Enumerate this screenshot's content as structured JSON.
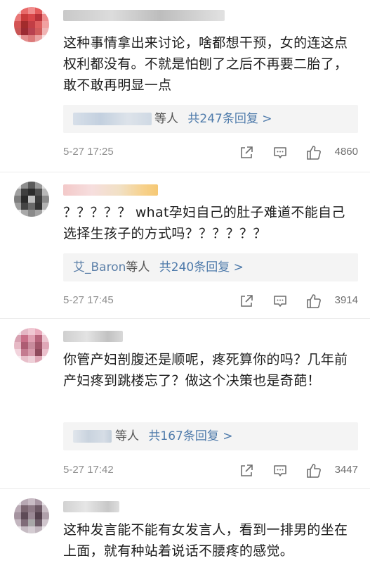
{
  "comments": [
    {
      "text": "这种事情拿出来讨论，啥都想干预，女的连这点权利都没有。不就是怕刨了之后不再要二胎了，敢不敢再明显一点",
      "reply_summary": {
        "who": "",
        "suffix": "等人",
        "count": "共247条回复 >"
      },
      "time": "5-27 17:25",
      "likes": "4860"
    },
    {
      "text": "？？？？？ what孕妇自己的肚子难道不能自己选择生孩子的方式吗？？？？？？",
      "reply_summary": {
        "who": "艾_Baron",
        "suffix": "等人",
        "count": "共240条回复 >"
      },
      "time": "5-27 17:45",
      "likes": "3914"
    },
    {
      "text": "你管产妇剖腹还是顺呢，疼死算你的吗？几年前产妇疼到跳楼忘了？做这个决策也是奇葩！",
      "reply_summary": {
        "who": "",
        "suffix": "等人",
        "count": "共167条回复 >"
      },
      "time": "5-27 17:42",
      "likes": "3447"
    },
    {
      "text": "这种发言能不能有女发言人，看到一排男的坐在上面，就有种站着说话不腰疼的感觉。"
    }
  ],
  "icons": {
    "share": "share-icon",
    "comment": "comment-icon",
    "like": "thumbs-up-icon"
  },
  "colors": {
    "link_blue": "#4f7bab",
    "time_gray": "#8e8e8e",
    "reply_bg": "#f4f4f4"
  }
}
